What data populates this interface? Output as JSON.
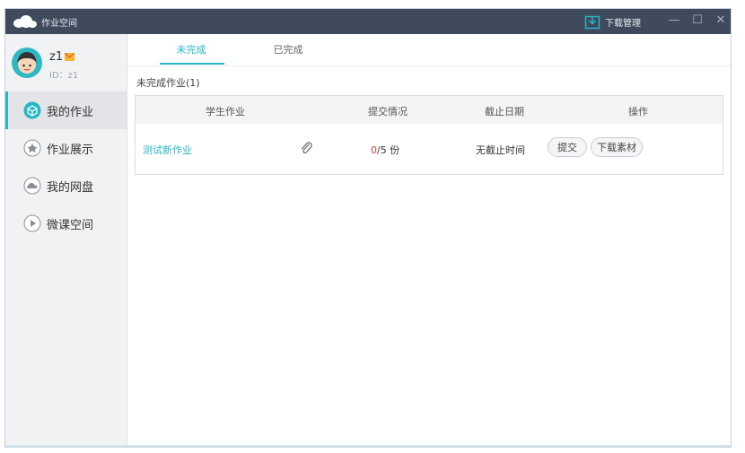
{
  "titlebar": {
    "app_title": "作业空间",
    "download_manager": "下载管理",
    "minimize": "—",
    "maximize": "☐",
    "close": "✕"
  },
  "profile": {
    "name": "z1",
    "id_text": "ID：z1"
  },
  "sidebar": {
    "items": [
      {
        "label": "我的作业",
        "icon": "homework-icon",
        "active": true
      },
      {
        "label": "作业展示",
        "icon": "showcase-icon",
        "active": false
      },
      {
        "label": "我的网盘",
        "icon": "cloud-disk-icon",
        "active": false
      },
      {
        "label": "微课空间",
        "icon": "play-icon",
        "active": false
      }
    ]
  },
  "tabs": [
    {
      "label": "未完成",
      "active": true
    },
    {
      "label": "已完成",
      "active": false
    }
  ],
  "section_title": "未完成作业(1)",
  "table": {
    "headers": [
      "学生作业",
      "提交情况",
      "截止日期",
      "操作"
    ],
    "rows": [
      {
        "name": "测试新作业",
        "submitted": "0",
        "total": "/5 份",
        "deadline": "无截止时间",
        "actions": [
          "提交",
          "下载素材"
        ]
      }
    ]
  },
  "colors": {
    "accent": "#26b6c4",
    "titlebar": "#3f4a5c",
    "sidebar_bg": "#f1f2f4",
    "alert": "#e0453a"
  }
}
